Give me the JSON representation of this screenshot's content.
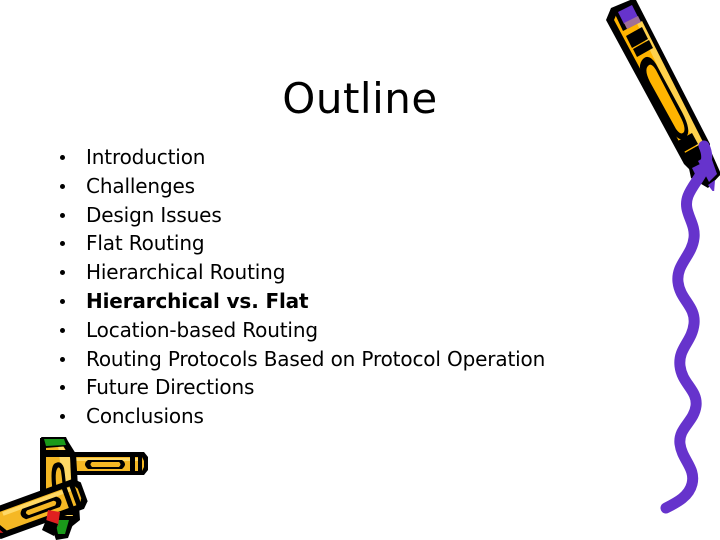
{
  "slide": {
    "title": "Outline",
    "background_color": "#FFFFFF",
    "text_color": "#000000",
    "bullets": [
      {
        "text": "Introduction",
        "bold": false
      },
      {
        "text": "Challenges",
        "bold": false
      },
      {
        "text": "Design Issues",
        "bold": false
      },
      {
        "text": "Flat Routing",
        "bold": false
      },
      {
        "text": "Hierarchical Routing",
        "bold": false
      },
      {
        "text": "Hierarchical vs. Flat",
        "bold": true
      },
      {
        "text": "Location-based Routing",
        "bold": false
      },
      {
        "text": "Routing Protocols Based on Protocol Operation",
        "bold": false
      },
      {
        "text": "Future Directions",
        "bold": false
      },
      {
        "text": "Conclusions",
        "bold": false
      }
    ]
  },
  "decorations": {
    "crayon_top_right": {
      "name": "yellow-crayon",
      "body_color": "#FFB400",
      "body_highlight": "#FFD24D",
      "outline_color": "#000000",
      "tip_color": "#6633CC"
    },
    "squiggle_right": {
      "name": "purple-squiggle",
      "stroke_color": "#6633CC"
    },
    "crayons_bottom_left": {
      "name": "crayon-cluster",
      "body_color": "#F5B824",
      "body_highlight": "#FFD966",
      "outline_color": "#000000",
      "tip_colors": [
        "#E02020",
        "#1A9A1A"
      ]
    }
  }
}
